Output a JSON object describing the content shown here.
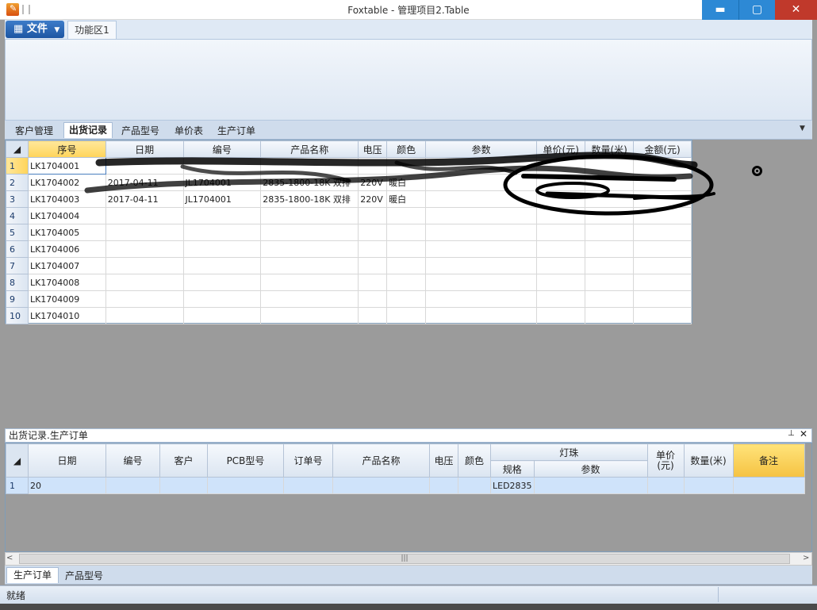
{
  "window": {
    "title": "Foxtable - 管理项目2.Table",
    "min_icon": "minimize-icon",
    "max_icon": "maximize-icon",
    "close_icon": "close-icon",
    "min_glyph": "▬",
    "max_glyph": "▢",
    "close_glyph": "✕",
    "logo_glyph": "✎"
  },
  "ribbon": {
    "file_label": "文件",
    "file_icon": "grid-icon",
    "file_glyph": "▦",
    "tabs": [
      {
        "label": "功能区1"
      }
    ]
  },
  "sheet_tabs": {
    "items": [
      {
        "label": "客户管理",
        "active": false
      },
      {
        "label": "出货记录",
        "active": true
      },
      {
        "label": "产品型号",
        "active": false
      },
      {
        "label": "单价表",
        "active": false
      },
      {
        "label": "生产订单",
        "active": false
      }
    ],
    "dropdown_glyph": "▼"
  },
  "grid1": {
    "columns": [
      "序号",
      "日期",
      "编号",
      "产品名称",
      "电压",
      "颜色",
      "参数",
      "单价(元)",
      "数量(米)",
      "金额(元)"
    ],
    "rows": [
      {
        "num": "1",
        "cells": [
          "LK1704001",
          "",
          "",
          "",
          "",
          "",
          "",
          "",
          "",
          ""
        ]
      },
      {
        "num": "2",
        "cells": [
          "LK1704002",
          "2017-04-11",
          "JL1704001",
          "2835-1800-18K 双排",
          "220V",
          "暖白",
          "",
          "",
          "",
          ""
        ]
      },
      {
        "num": "3",
        "cells": [
          "LK1704003",
          "2017-04-11",
          "JL1704001",
          "2835-1800-18K 双排",
          "220V",
          "暖白",
          "",
          "",
          "",
          ""
        ]
      },
      {
        "num": "4",
        "cells": [
          "LK1704004",
          "",
          "",
          "",
          "",
          "",
          "",
          "",
          "",
          ""
        ]
      },
      {
        "num": "5",
        "cells": [
          "LK1704005",
          "",
          "",
          "",
          "",
          "",
          "",
          "",
          "",
          ""
        ]
      },
      {
        "num": "6",
        "cells": [
          "LK1704006",
          "",
          "",
          "",
          "",
          "",
          "",
          "",
          "",
          ""
        ]
      },
      {
        "num": "7",
        "cells": [
          "LK1704007",
          "",
          "",
          "",
          "",
          "",
          "",
          "",
          "",
          ""
        ]
      },
      {
        "num": "8",
        "cells": [
          "LK1704008",
          "",
          "",
          "",
          "",
          "",
          "",
          "",
          "",
          ""
        ]
      },
      {
        "num": "9",
        "cells": [
          "LK1704009",
          "",
          "",
          "",
          "",
          "",
          "",
          "",
          "",
          ""
        ]
      },
      {
        "num": "10",
        "cells": [
          "LK1704010",
          "",
          "",
          "",
          "",
          "",
          "",
          "",
          "",
          ""
        ]
      }
    ]
  },
  "pane2": {
    "title": "出货记录.生产订单",
    "pin_glyph": "📌",
    "close_glyph": "✕",
    "columns_top": [
      "日期",
      "编号",
      "客户",
      "PCB型号",
      "订单号",
      "产品名称",
      "电压",
      "颜色",
      "灯珠",
      "单价(元)",
      "数量(米)",
      "备注"
    ],
    "columns_sub": [
      "规格",
      "参数"
    ],
    "rows": [
      {
        "num": "1",
        "cells": [
          "20",
          "",
          "",
          "",
          "",
          "",
          "",
          "",
          "LED2835",
          "",
          "",
          "",
          ""
        ]
      }
    ]
  },
  "scrollbar": {
    "left_glyph": "<",
    "right_glyph": ">",
    "thumb_glyph": "|||"
  },
  "bottom_tabs": [
    {
      "label": "生产订单",
      "active": true
    },
    {
      "label": "产品型号",
      "active": false
    }
  ],
  "status": {
    "text": "就绪"
  }
}
